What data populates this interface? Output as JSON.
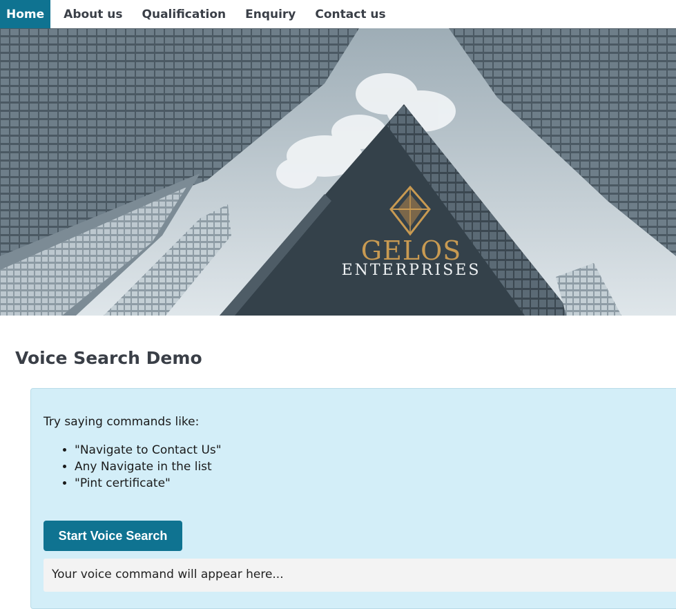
{
  "nav": {
    "items": [
      {
        "label": "Home",
        "active": true
      },
      {
        "label": "About us",
        "active": false
      },
      {
        "label": "Qualification",
        "active": false
      },
      {
        "label": "Enquiry",
        "active": false
      },
      {
        "label": "Contact us",
        "active": false
      }
    ]
  },
  "hero": {
    "logo_line1": "GELOS",
    "logo_line2": "ENTERPRISES"
  },
  "main": {
    "title": "Voice Search Demo",
    "intro": "Try saying commands like:",
    "commands": [
      "\"Navigate to Contact Us\"",
      "Any Navigate in the list",
      "\"Pint certificate\""
    ],
    "button_label": "Start Voice Search",
    "output_placeholder": "Your voice command will appear here..."
  },
  "colors": {
    "accent": "#0f7391",
    "panel": "#d3eef8",
    "logo_gold": "#c89a52"
  }
}
